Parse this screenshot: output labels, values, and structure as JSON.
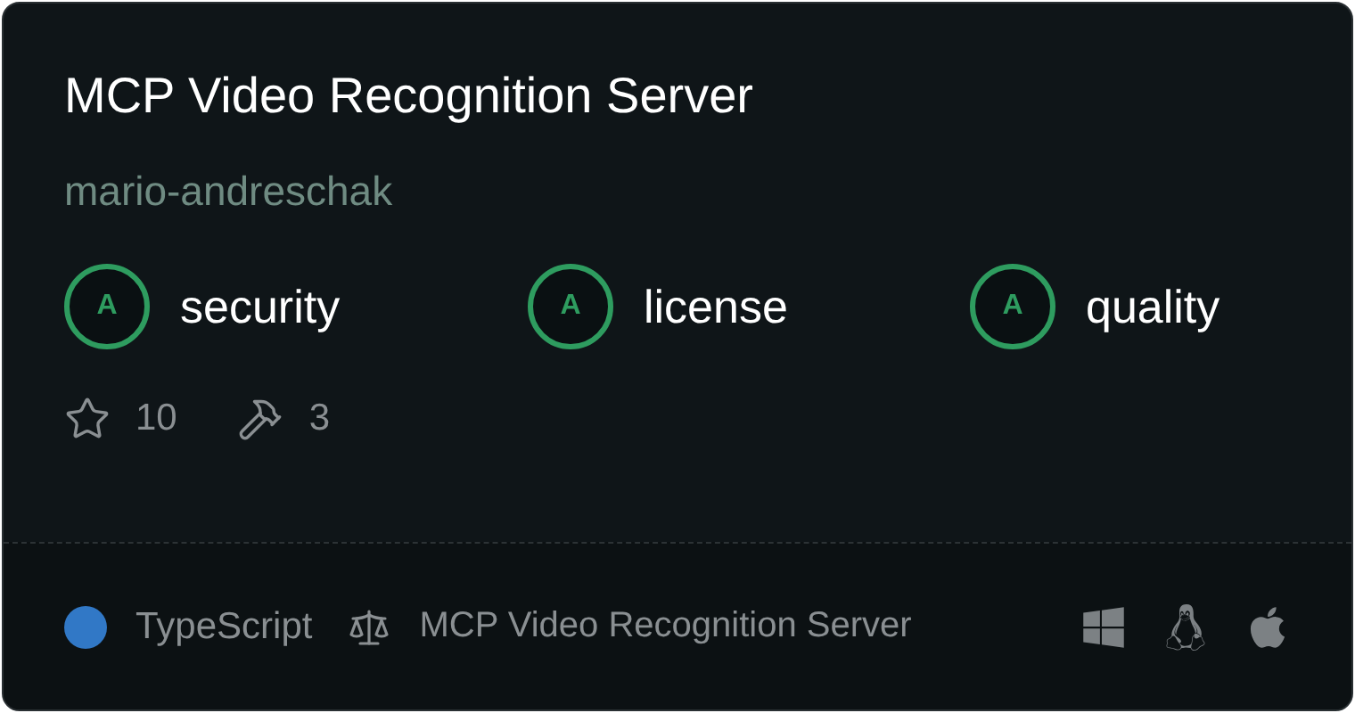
{
  "title": "MCP Video Recognition Server",
  "author": "mario-andreschak",
  "scores": [
    {
      "grade": "A",
      "label": "security"
    },
    {
      "grade": "A",
      "label": "license"
    },
    {
      "grade": "A",
      "label": "quality"
    }
  ],
  "stats": {
    "stars": "10",
    "tools": "3"
  },
  "footer": {
    "language": {
      "name": "TypeScript",
      "color": "#3178c6"
    },
    "license": "MCP Video Recognition Server",
    "platforms": [
      {
        "kind": "windows"
      },
      {
        "kind": "linux"
      },
      {
        "kind": "apple"
      }
    ]
  }
}
